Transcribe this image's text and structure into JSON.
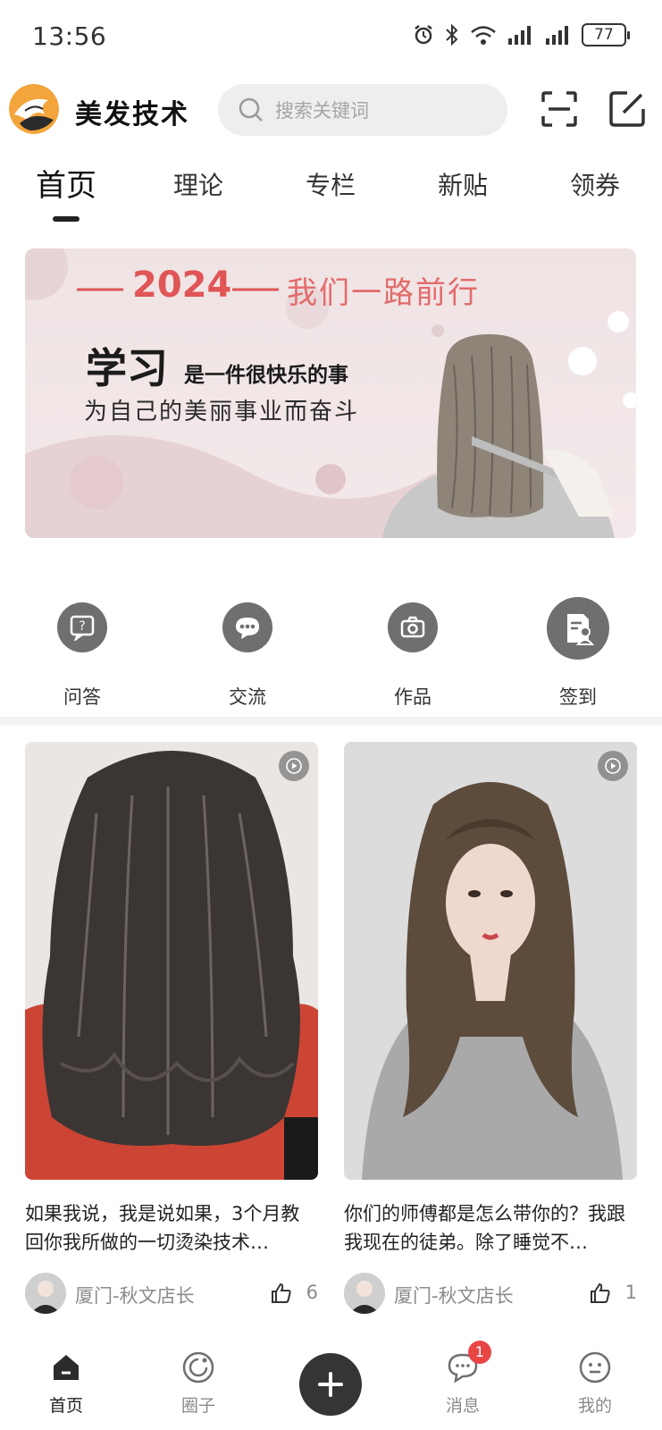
{
  "status_bar": {
    "time": "13:56",
    "battery": "77"
  },
  "header": {
    "app_title": "美发技术",
    "search_placeholder": "搜索关键词"
  },
  "tabs": [
    {
      "label": "首页",
      "active": true
    },
    {
      "label": "理论"
    },
    {
      "label": "专栏"
    },
    {
      "label": "新贴"
    },
    {
      "label": "领券"
    }
  ],
  "banner": {
    "year": "2024",
    "slogan": "我们一路前行",
    "headline_big": "学习",
    "headline_small": "是一件很快乐的事",
    "subline": "为自己的美丽事业而奋斗"
  },
  "quick_actions": [
    {
      "label": "问答",
      "icon": "question-icon"
    },
    {
      "label": "交流",
      "icon": "chat-icon"
    },
    {
      "label": "作品",
      "icon": "camera-icon"
    },
    {
      "label": "签到",
      "icon": "checkin-icon"
    }
  ],
  "feed": [
    {
      "title": "如果我说，我是说如果，3个月教回你我所做的一切烫染技术…",
      "author": "厦门-秋文店长",
      "likes": "6",
      "video": true
    },
    {
      "title": "你们的师傅都是怎么带你的？我跟我现在的徒弟。除了睡觉不…",
      "author": "厦门-秋文店长",
      "likes": "1",
      "video": true
    }
  ],
  "bottom_nav": [
    {
      "label": "首页",
      "icon": "home-icon",
      "active": true
    },
    {
      "label": "圈子",
      "icon": "circle-icon"
    },
    {
      "label": "",
      "icon": "plus-icon"
    },
    {
      "label": "消息",
      "icon": "message-icon",
      "badge": "1"
    },
    {
      "label": "我的",
      "icon": "profile-icon"
    }
  ],
  "colors": {
    "accent_red": "#e05555",
    "nav_dark": "#353535",
    "badge": "#e84545"
  }
}
